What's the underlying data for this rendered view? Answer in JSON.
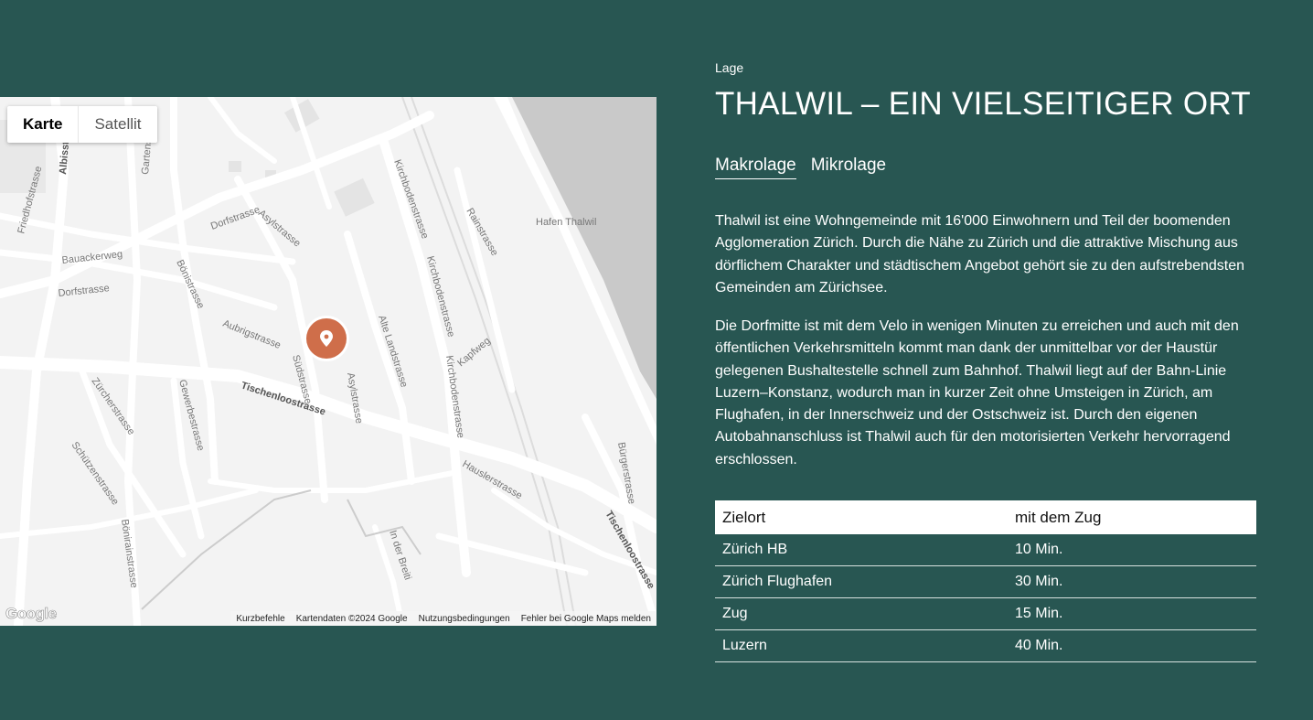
{
  "map": {
    "type_buttons": [
      "Karte",
      "Satellit"
    ],
    "street_labels": [
      "Dorfstrasse",
      "Asylstrasse",
      "Bauackerweg",
      "Dorfstrasse",
      "Bönistrasse",
      "Aubrigstrasse",
      "Südstrasse",
      "Asylstrasse",
      "Alte Landstrasse",
      "Kirchbodenstrasse",
      "Kirchbodenstrasse",
      "Kirchbodenstrasse",
      "Kapfweg",
      "Rainstrasse",
      "Tischenloostrasse",
      "Zürcherstrasse",
      "Gewerbestrasse",
      "Schützenstrasse",
      "Bönirainstrasse",
      "Gartenstrasse",
      "Friedhofstrasse",
      "Albisstrasse",
      "Hauslerstrasse",
      "Bürgerstrasse",
      "Tischenloostrasse",
      "In der Breiti",
      "Hafen Thalwil"
    ],
    "logo": "Google",
    "footer": [
      "Kurzbefehle",
      "Kartendaten ©2024 Google",
      "Nutzungsbedingungen",
      "Fehler bei Google Maps melden"
    ],
    "marker_icon": "location-pin-icon"
  },
  "section": {
    "eyebrow": "Lage",
    "title": "THALWIL – EIN VIELSEITIGER ORT",
    "tabs": [
      "Makrolage",
      "Mikrolage"
    ],
    "paragraphs": [
      "Thalwil ist eine Wohngemeinde mit 16'000 Einwohnern und Teil der boomenden Agglomeration Zürich. Durch die Nähe zu Zürich und die attraktive Mischung aus dörflichem Charakter und städtischem Angebot gehört sie zu den aufstrebendsten Gemeinden am Zürichsee.",
      "Die Dorfmitte ist mit dem Velo in wenigen Minuten zu erreichen und auch mit den öffentlichen Verkehrsmitteln kommt man dank der unmittelbar vor der Haustür gelegenen Bushaltestelle schnell zum Bahnhof. Thalwil liegt auf der Bahn-Linie Luzern–Konstanz, wodurch man in kurzer Zeit ohne Umsteigen in Zürich, am Flughafen, in der Innerschweiz und der Ostschweiz ist. Durch den eigenen Autobahnanschluss ist Thalwil auch für den motorisierten Verkehr hervorragend erschlossen."
    ]
  },
  "table": {
    "headers": [
      "Zielort",
      "mit dem Zug"
    ],
    "rows": [
      [
        "Zürich HB",
        "10 Min."
      ],
      [
        "Zürich Flughafen",
        "30 Min."
      ],
      [
        "Zug",
        "15 Min."
      ],
      [
        "Luzern",
        "40 Min."
      ]
    ]
  },
  "colors": {
    "background": "#285652",
    "marker": "#cf6e4a"
  }
}
